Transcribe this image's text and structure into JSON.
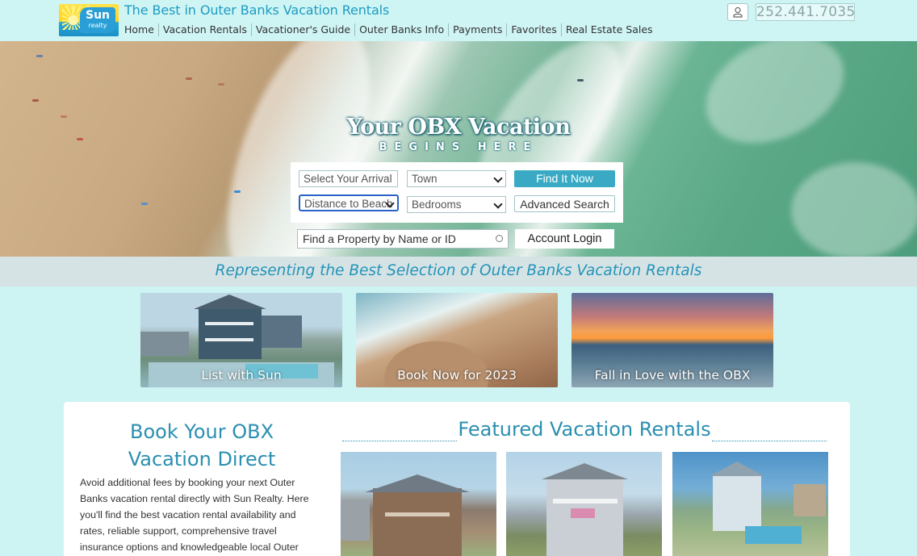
{
  "header": {
    "logo": {
      "line1": "Sun",
      "line2": "realty"
    },
    "tagline": "The Best in Outer Banks Vacation Rentals",
    "nav": [
      "Home",
      "Vacation Rentals",
      "Vacationer's Guide",
      "Outer Banks Info",
      "Payments",
      "Favorites",
      "Real Estate Sales"
    ],
    "phone": "252.441.7035",
    "user_icon": "user-icon"
  },
  "hero": {
    "title": "Your OBX Vacation",
    "subtitle": "BEGINS HERE",
    "search": {
      "arrival_placeholder": "Select Your Arrival",
      "town_selected": "Town",
      "distance_selected": "Distance to Beach",
      "bedrooms_selected": "Bedrooms",
      "find_label": "Find It Now",
      "advanced_label": "Advanced Search",
      "property_placeholder": "Find a Property by Name or ID",
      "login_label": "Account Login"
    }
  },
  "representing": "Representing the Best Selection of Outer Banks Vacation Rentals",
  "tiles": [
    {
      "label": "List with Sun"
    },
    {
      "label": "Book Now for 2023"
    },
    {
      "label": "Fall in Love with the OBX"
    }
  ],
  "direct": {
    "title_line1": "Book Your OBX",
    "title_line2": "Vacation Direct",
    "text": "Avoid additional fees by booking your next Outer Banks vacation rental directly with Sun Realty. Here you'll find the best vacation rental availability and rates, reliable support, comprehensive travel insurance options and knowledgeable local Outer"
  },
  "featured": {
    "title": "Featured Vacation Rentals"
  },
  "colors": {
    "accent": "#2a8fb0",
    "button": "#3aaac4",
    "background": "#cdf3f3"
  }
}
